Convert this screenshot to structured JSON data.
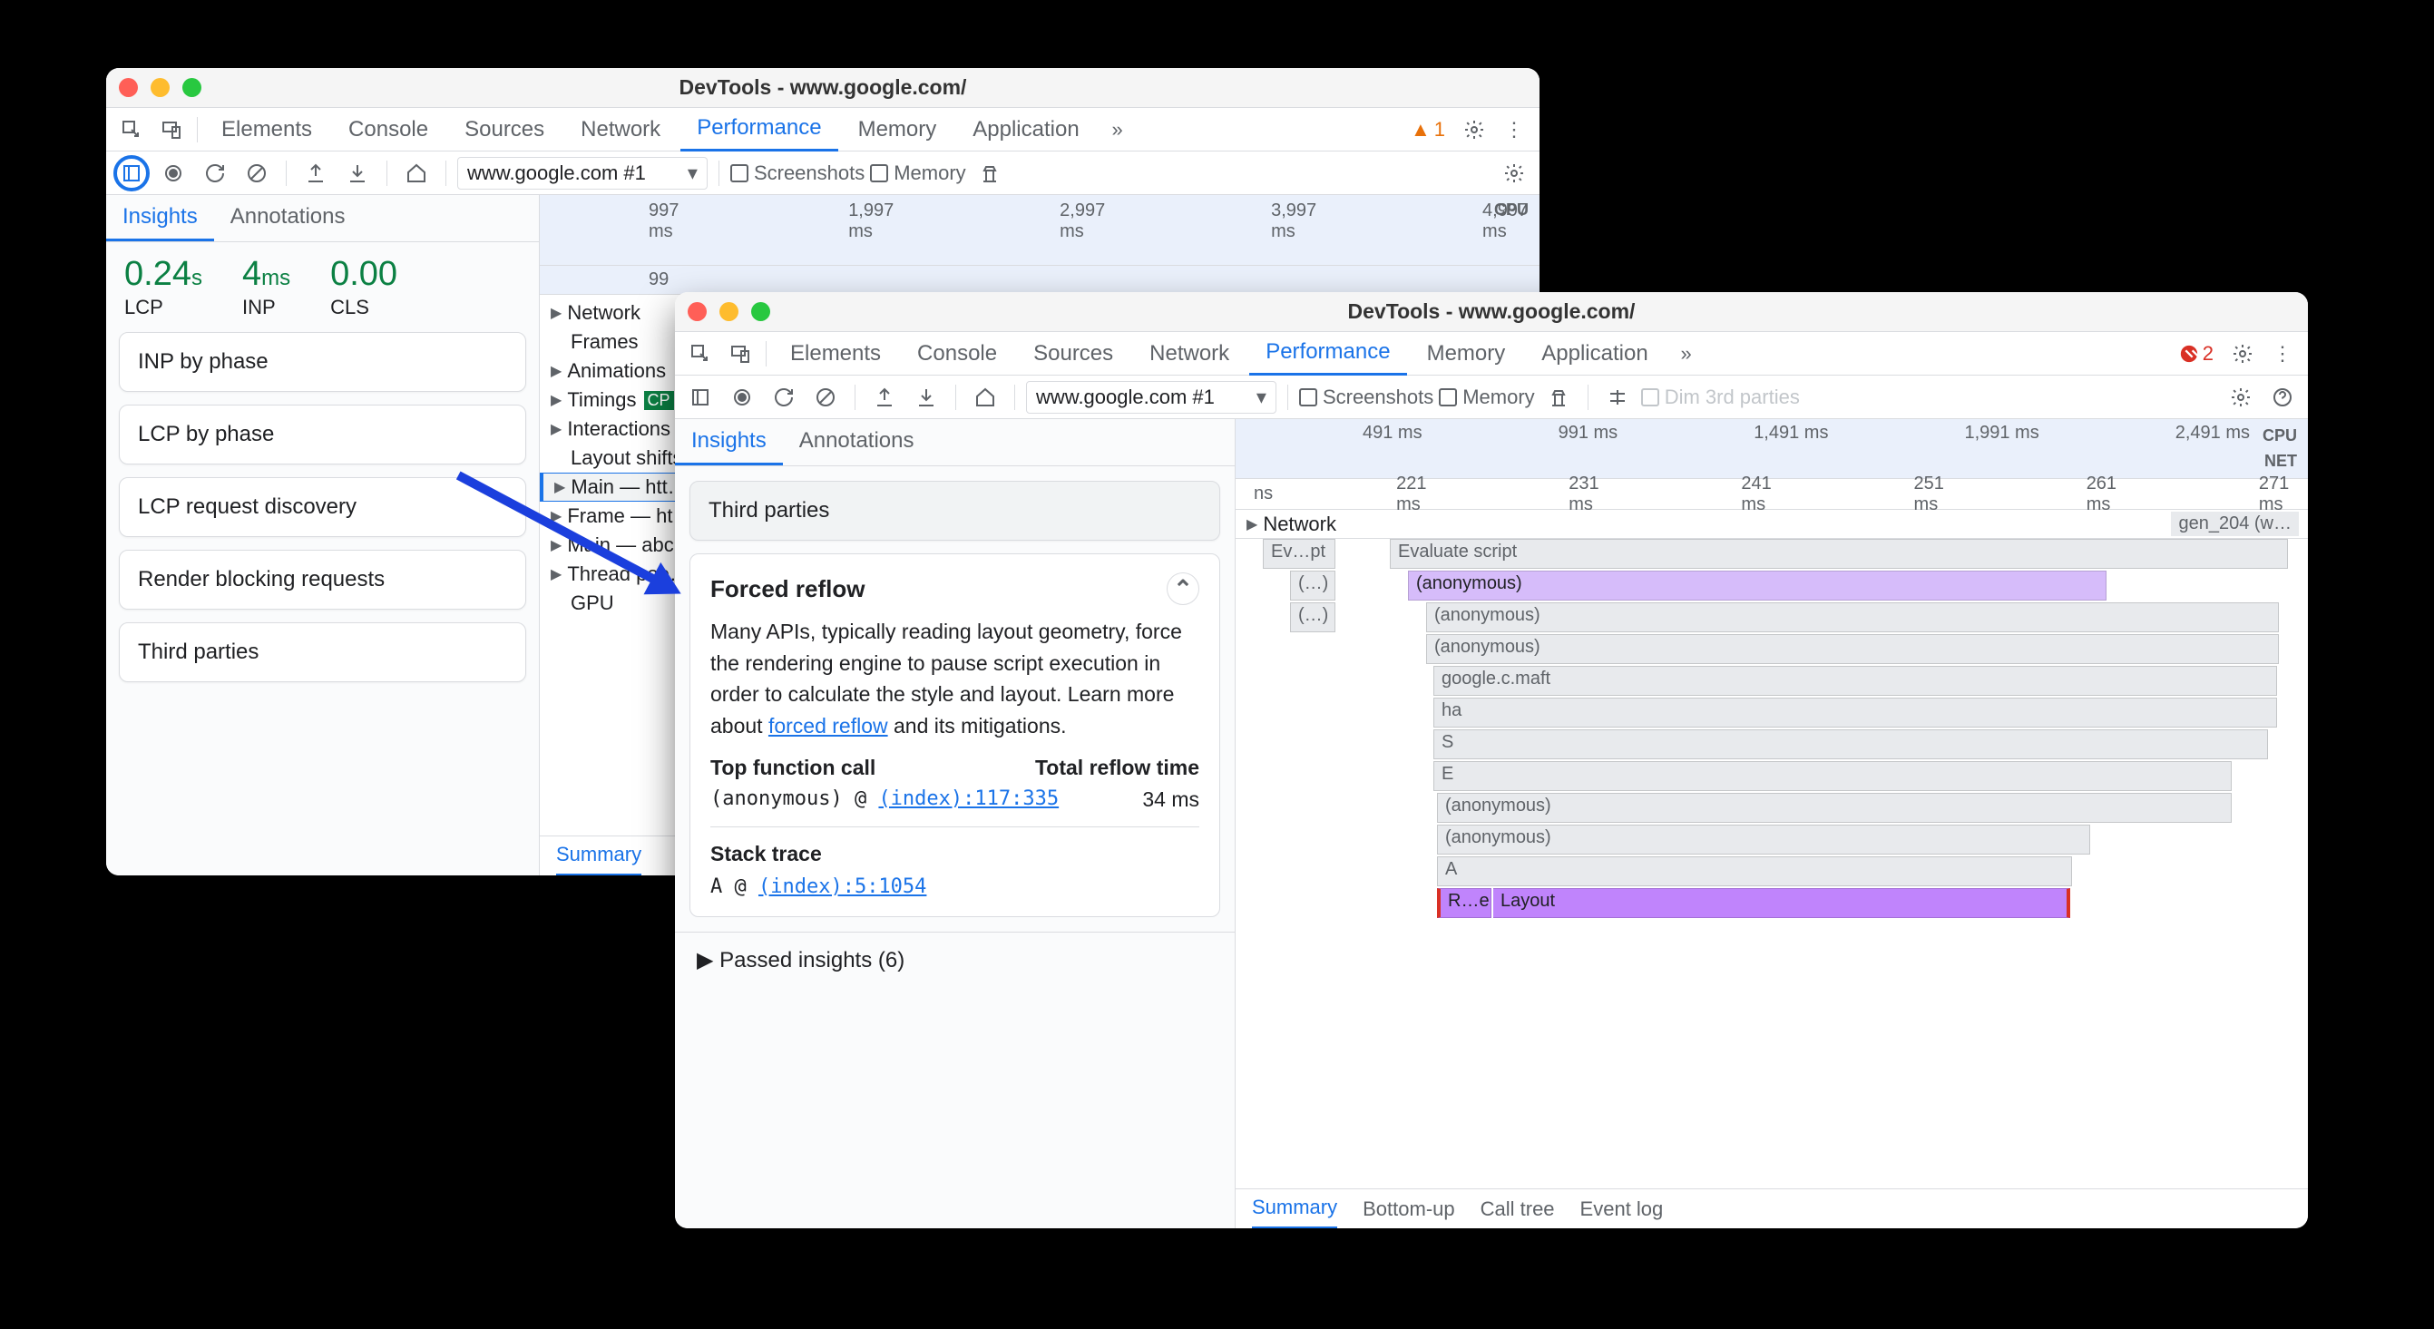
{
  "window1": {
    "title": "DevTools - www.google.com/",
    "tabs": [
      "Elements",
      "Console",
      "Sources",
      "Network",
      "Performance",
      "Memory",
      "Application"
    ],
    "active_tab": "Performance",
    "warning_count": 1,
    "url_select": "www.google.com #1",
    "screenshots_label": "Screenshots",
    "memory_label": "Memory",
    "sidebar_tabs": [
      "Insights",
      "Annotations"
    ],
    "active_sidebar_tab": "Insights",
    "metrics": [
      {
        "value": "0.24",
        "unit": "s",
        "label": "LCP"
      },
      {
        "value": "4",
        "unit": "ms",
        "label": "INP"
      },
      {
        "value": "0.00",
        "unit": "",
        "label": "CLS"
      }
    ],
    "insights": [
      "INP by phase",
      "LCP by phase",
      "LCP request discovery",
      "Render blocking requests",
      "Third parties"
    ],
    "ruler_ticks": [
      "997 ms",
      "1,997 ms",
      "2,997 ms",
      "3,997 ms",
      "4,997 ms"
    ],
    "cpu_label": "CPU",
    "r2_pre": "99",
    "tracks": [
      "Network",
      "Frames",
      "Animations",
      "Timings",
      "Interactions",
      "Layout shifts",
      "Main — htt…",
      "Frame — ht…",
      "Main — abc…",
      "Thread poo…",
      "GPU"
    ],
    "timings_badge": "CP",
    "bottom_tab": "Summary"
  },
  "window2": {
    "title": "DevTools - www.google.com/",
    "tabs": [
      "Elements",
      "Console",
      "Sources",
      "Network",
      "Performance",
      "Memory",
      "Application"
    ],
    "active_tab": "Performance",
    "error_count": 2,
    "url_select": "www.google.com #1",
    "screenshots_label": "Screenshots",
    "memory_label": "Memory",
    "dim_label": "Dim 3rd parties",
    "sidebar_tabs": [
      "Insights",
      "Annotations"
    ],
    "active_sidebar_tab": "Insights",
    "third_parties_card": "Third parties",
    "forced_reflow": {
      "title": "Forced reflow",
      "body_pre": "Many APIs, typically reading layout geometry, force the rendering engine to pause script execution in order to calculate the style and layout. Learn more about ",
      "link": "forced reflow",
      "body_post": " and its mitigations.",
      "col1": "Top function call",
      "col2": "Total reflow time",
      "fn": "(anonymous) @ ",
      "fn_link": "(index):117:335",
      "time": "34 ms",
      "stack_title": "Stack trace",
      "stack_fn": "A @ ",
      "stack_link": "(index):5:1054"
    },
    "passed_insights": "Passed insights (6)",
    "ruler_ticks_top": [
      "491 ms",
      "991 ms",
      "1,491 ms",
      "1,991 ms",
      "2,491 ms"
    ],
    "ruler_ticks_mid": [
      "ns",
      "221 ms",
      "231 ms",
      "241 ms",
      "251 ms",
      "261 ms",
      "271 ms"
    ],
    "cpu_label": "CPU",
    "net_label": "NET",
    "network_track": "Network",
    "gen_label": "gen_204 (w…",
    "flame": {
      "l0a": "Ev…pt",
      "l0b": "Evaluate script",
      "l1a": "(…)",
      "l1b": "(anonymous)",
      "l2a": "(…)",
      "l2b": "(anonymous)",
      "l3": "(anonymous)",
      "l4": "google.c.maft",
      "l5": "ha",
      "l6": "S",
      "l7": "E",
      "l8": "(anonymous)",
      "l9": "(anonymous)",
      "l10": "A",
      "l11a": "R…e",
      "l11b": "Layout"
    },
    "bottom_tabs": [
      "Summary",
      "Bottom-up",
      "Call tree",
      "Event log"
    ],
    "active_bottom_tab": "Summary"
  }
}
